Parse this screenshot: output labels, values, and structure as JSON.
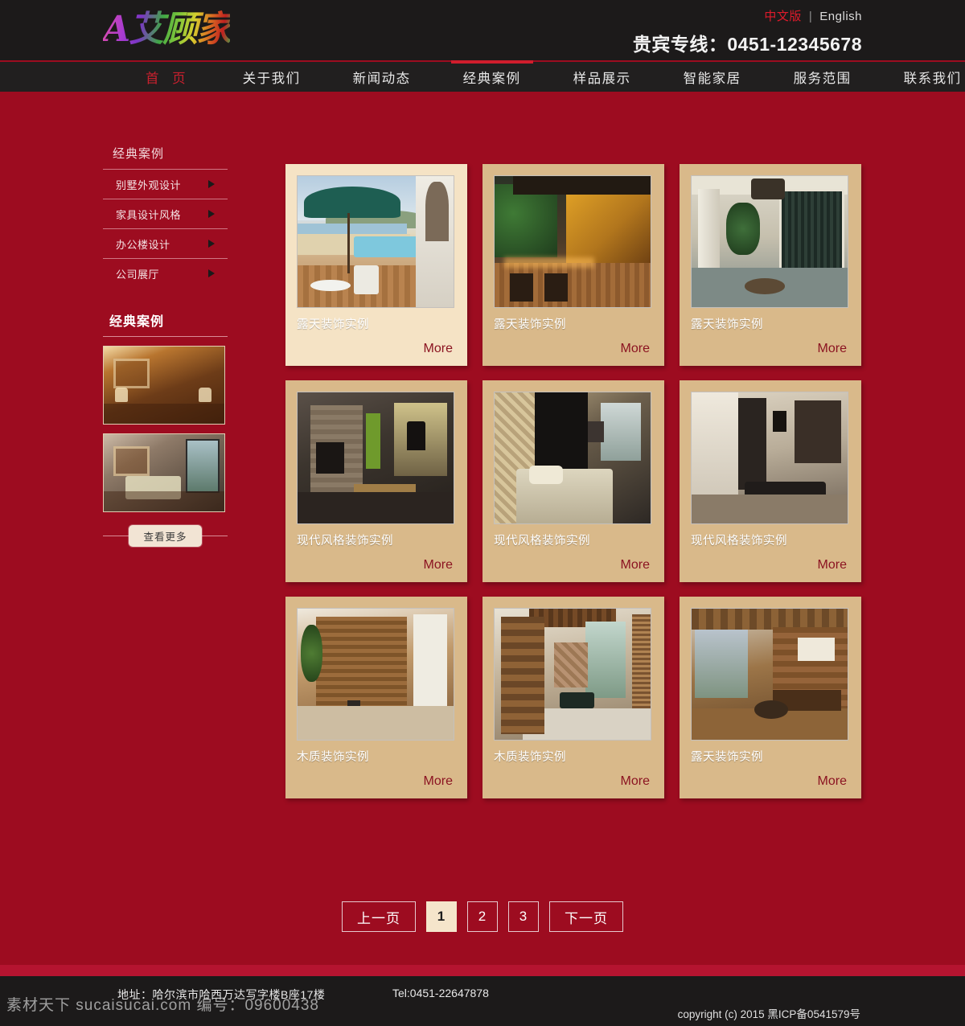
{
  "header": {
    "logo_text": "A艾顾家",
    "lang_cn": "中文版",
    "lang_sep": "|",
    "lang_en": "English",
    "hotline": "贵宾专线：0451-12345678"
  },
  "nav": {
    "items": [
      {
        "label": "首 页",
        "active": false,
        "home": true
      },
      {
        "label": "关于我们",
        "active": false
      },
      {
        "label": "新闻动态",
        "active": false
      },
      {
        "label": "经典案例",
        "active": true
      },
      {
        "label": "样品展示",
        "active": false
      },
      {
        "label": "智能家居",
        "active": false
      },
      {
        "label": "服务范围",
        "active": false
      },
      {
        "label": "联系我们",
        "active": false
      }
    ]
  },
  "breadcrumb": "经典案例",
  "sidebar": {
    "categories": [
      {
        "label": "别墅外观设计"
      },
      {
        "label": "家具设计风格"
      },
      {
        "label": "办公楼设计"
      },
      {
        "label": "公司展厅"
      }
    ],
    "heading": "经典案例",
    "thumb_1_alt": "classic-interior-living-room",
    "thumb_2_alt": "classic-interior-bedroom",
    "more_button": "查看更多"
  },
  "gallery": {
    "more_label": "More",
    "cards": [
      {
        "title": "露天装饰实例",
        "theme": "cream",
        "img": "i1"
      },
      {
        "title": "露天装饰实例",
        "theme": "tan",
        "img": "i2"
      },
      {
        "title": "露天装饰实例",
        "theme": "tan",
        "img": "i3"
      },
      {
        "title": "现代风格装饰实例",
        "theme": "tan",
        "img": "i4"
      },
      {
        "title": "现代风格装饰实例",
        "theme": "tan",
        "img": "i5"
      },
      {
        "title": "现代风格装饰实例",
        "theme": "tan",
        "img": "i6"
      },
      {
        "title": "木质装饰实例",
        "theme": "tan",
        "img": "i7"
      },
      {
        "title": "木质装饰实例",
        "theme": "tan",
        "img": "i8"
      },
      {
        "title": "露天装饰实例",
        "theme": "tan",
        "img": "i9"
      }
    ]
  },
  "pagination": {
    "prev": "上一页",
    "next": "下一页",
    "pages": [
      "1",
      "2",
      "3"
    ],
    "current": "1"
  },
  "footer": {
    "address": "地址：哈尔滨市哈西万达写字楼B座17楼",
    "tel": "Tel:0451-22647878",
    "copyright": "copyright (c)  2015  黑ICP备0541579号"
  },
  "watermark": "素材天下 sucaisucai.com  编号：09600438",
  "colors": {
    "page_bg": "#9d0c20",
    "header_bg": "#1c1a1a",
    "accent_red": "#d01d2c",
    "card_cream": "#f5e3c5",
    "card_tan": "#d9b98a",
    "more_red": "#8b1321"
  }
}
